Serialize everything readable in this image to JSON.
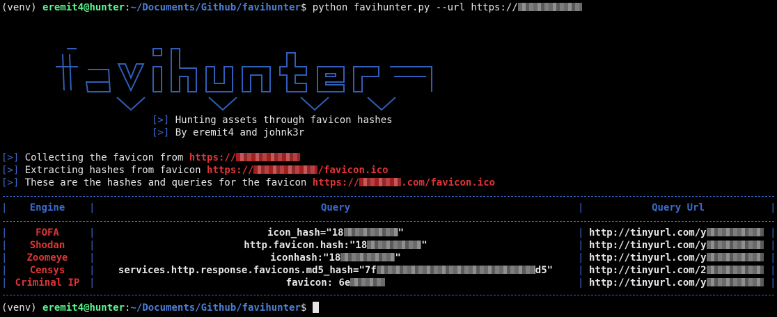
{
  "prompt": {
    "venv": "(venv) ",
    "user_host": "eremit4@hunter",
    "colon": ":",
    "path": "~/Documents/Github/favihunter",
    "dollar": "$ "
  },
  "command": "python favihunter.py --url https://",
  "banner": {
    "tagline_1": "Hunting assets through favicon hashes",
    "tagline_2": "By eremit4 and johnk3r",
    "bracket": "[>]"
  },
  "messages": [
    {
      "text": "Collecting the favicon from ",
      "url_prefix": "https://",
      "url_suffix": ""
    },
    {
      "text": "Extracting hashes from favicon ",
      "url_prefix": "https://",
      "url_suffix": "/favicon.ico"
    },
    {
      "text": "These are the hashes and queries for the favicon ",
      "url_prefix": "https://",
      "url_suffix": ".com/favicon.ico"
    }
  ],
  "table": {
    "headers": [
      "Engine",
      "Query",
      "Query Url"
    ],
    "rows": [
      {
        "engine": "FOFA",
        "query_prefix": "icon_hash=\"18",
        "query_suffix": "\"",
        "url_prefix": "http://tinyurl.com/y"
      },
      {
        "engine": "Shodan",
        "query_prefix": "http.favicon.hash:\"18",
        "query_suffix": "\"",
        "url_prefix": "http://tinyurl.com/y"
      },
      {
        "engine": "Zoomeye",
        "query_prefix": "iconhash:\"18",
        "query_suffix": "\"",
        "url_prefix": "http://tinyurl.com/y"
      },
      {
        "engine": "Censys",
        "query_prefix": "services.http.response.favicons.md5_hash=\"7f",
        "query_suffix": "d5\"",
        "url_prefix": "http://tinyurl.com/2"
      },
      {
        "engine": "Criminal IP",
        "query_prefix": "favicon: 6e",
        "query_suffix": "",
        "url_prefix": "http://tinyurl.com/y"
      }
    ]
  },
  "colors": {
    "background": "#000000",
    "prompt_green": "#5af78e",
    "path_blue": "#4b7fd6",
    "engine_red": "#e03434",
    "border_blue": "#3a6bd0"
  }
}
